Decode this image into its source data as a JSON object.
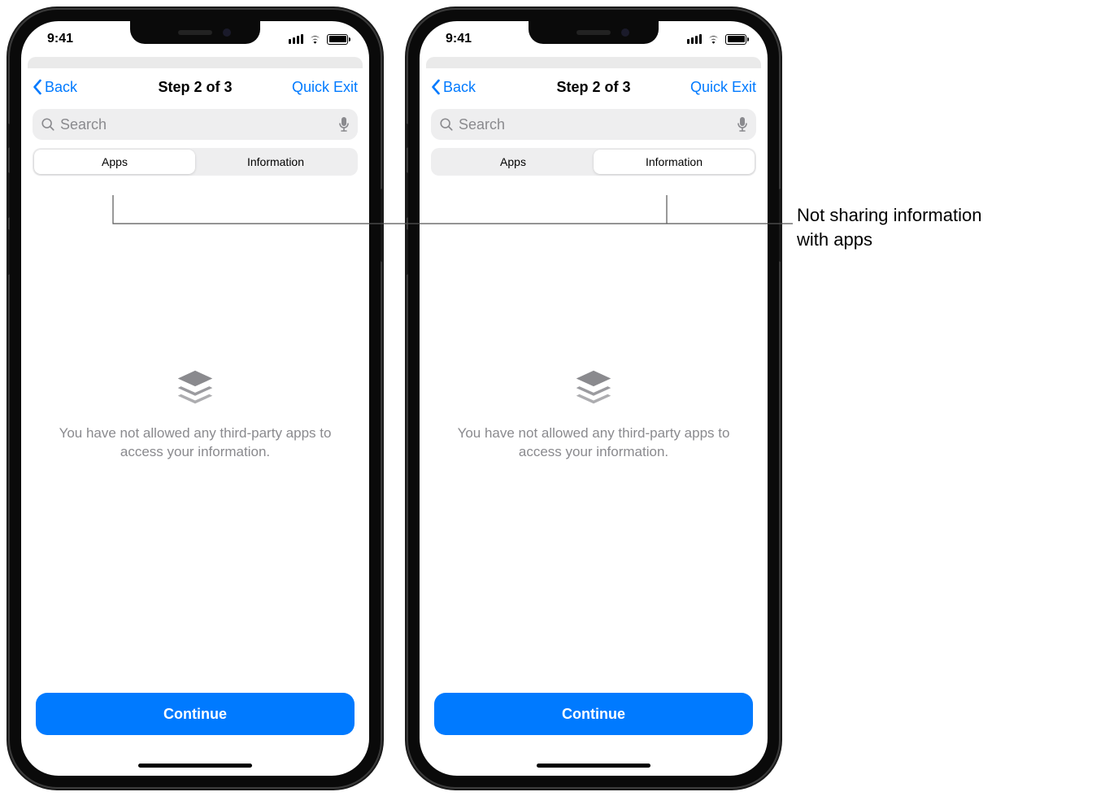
{
  "phones": [
    {
      "time": "9:41",
      "nav": {
        "back": "Back",
        "title": "Step 2 of 3",
        "action": "Quick Exit"
      },
      "search": {
        "placeholder": "Search"
      },
      "segments": {
        "apps": "Apps",
        "information": "Information",
        "active": "apps"
      },
      "empty": {
        "text": "You have not allowed any third-party apps to access your information."
      },
      "continue": "Continue"
    },
    {
      "time": "9:41",
      "nav": {
        "back": "Back",
        "title": "Step 2 of 3",
        "action": "Quick Exit"
      },
      "search": {
        "placeholder": "Search"
      },
      "segments": {
        "apps": "Apps",
        "information": "Information",
        "active": "information"
      },
      "empty": {
        "text": "You have not allowed any third-party apps to access your information."
      },
      "continue": "Continue"
    }
  ],
  "callout": {
    "line1": "Not sharing information",
    "line2": "with apps"
  }
}
